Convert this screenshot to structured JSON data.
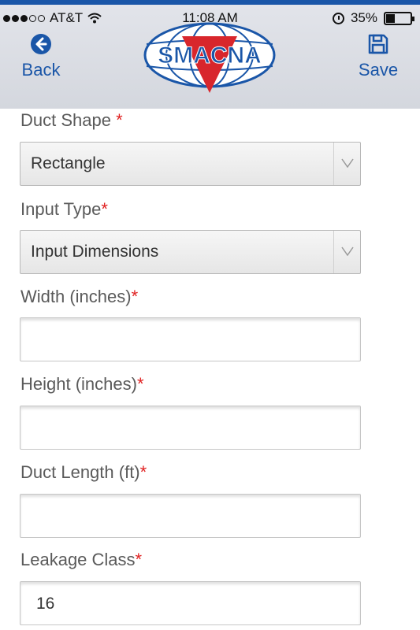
{
  "status_bar": {
    "carrier": "AT&T",
    "time": "11:08 AM",
    "battery": "35%",
    "signal_bars_filled": 3,
    "signal_bars_total": 5
  },
  "header": {
    "back_label": "Back",
    "save_label": "Save",
    "logo_text": "SMACNA",
    "accent_color": "#1a56a8",
    "logo_red": "#d8262c"
  },
  "form": {
    "duct_shape": {
      "label": "Duct Shape ",
      "required": "*",
      "value": "Rectangle"
    },
    "input_type": {
      "label": "Input Type",
      "required": "*",
      "value": "Input Dimensions"
    },
    "width": {
      "label": "Width (inches)",
      "required": "*",
      "value": ""
    },
    "height": {
      "label": "Height (inches)",
      "required": "*",
      "value": ""
    },
    "duct_length": {
      "label": "Duct Length (ft)",
      "required": "*",
      "value": ""
    },
    "leakage_class": {
      "label": "Leakage Class",
      "required": "*",
      "value": "16"
    }
  }
}
